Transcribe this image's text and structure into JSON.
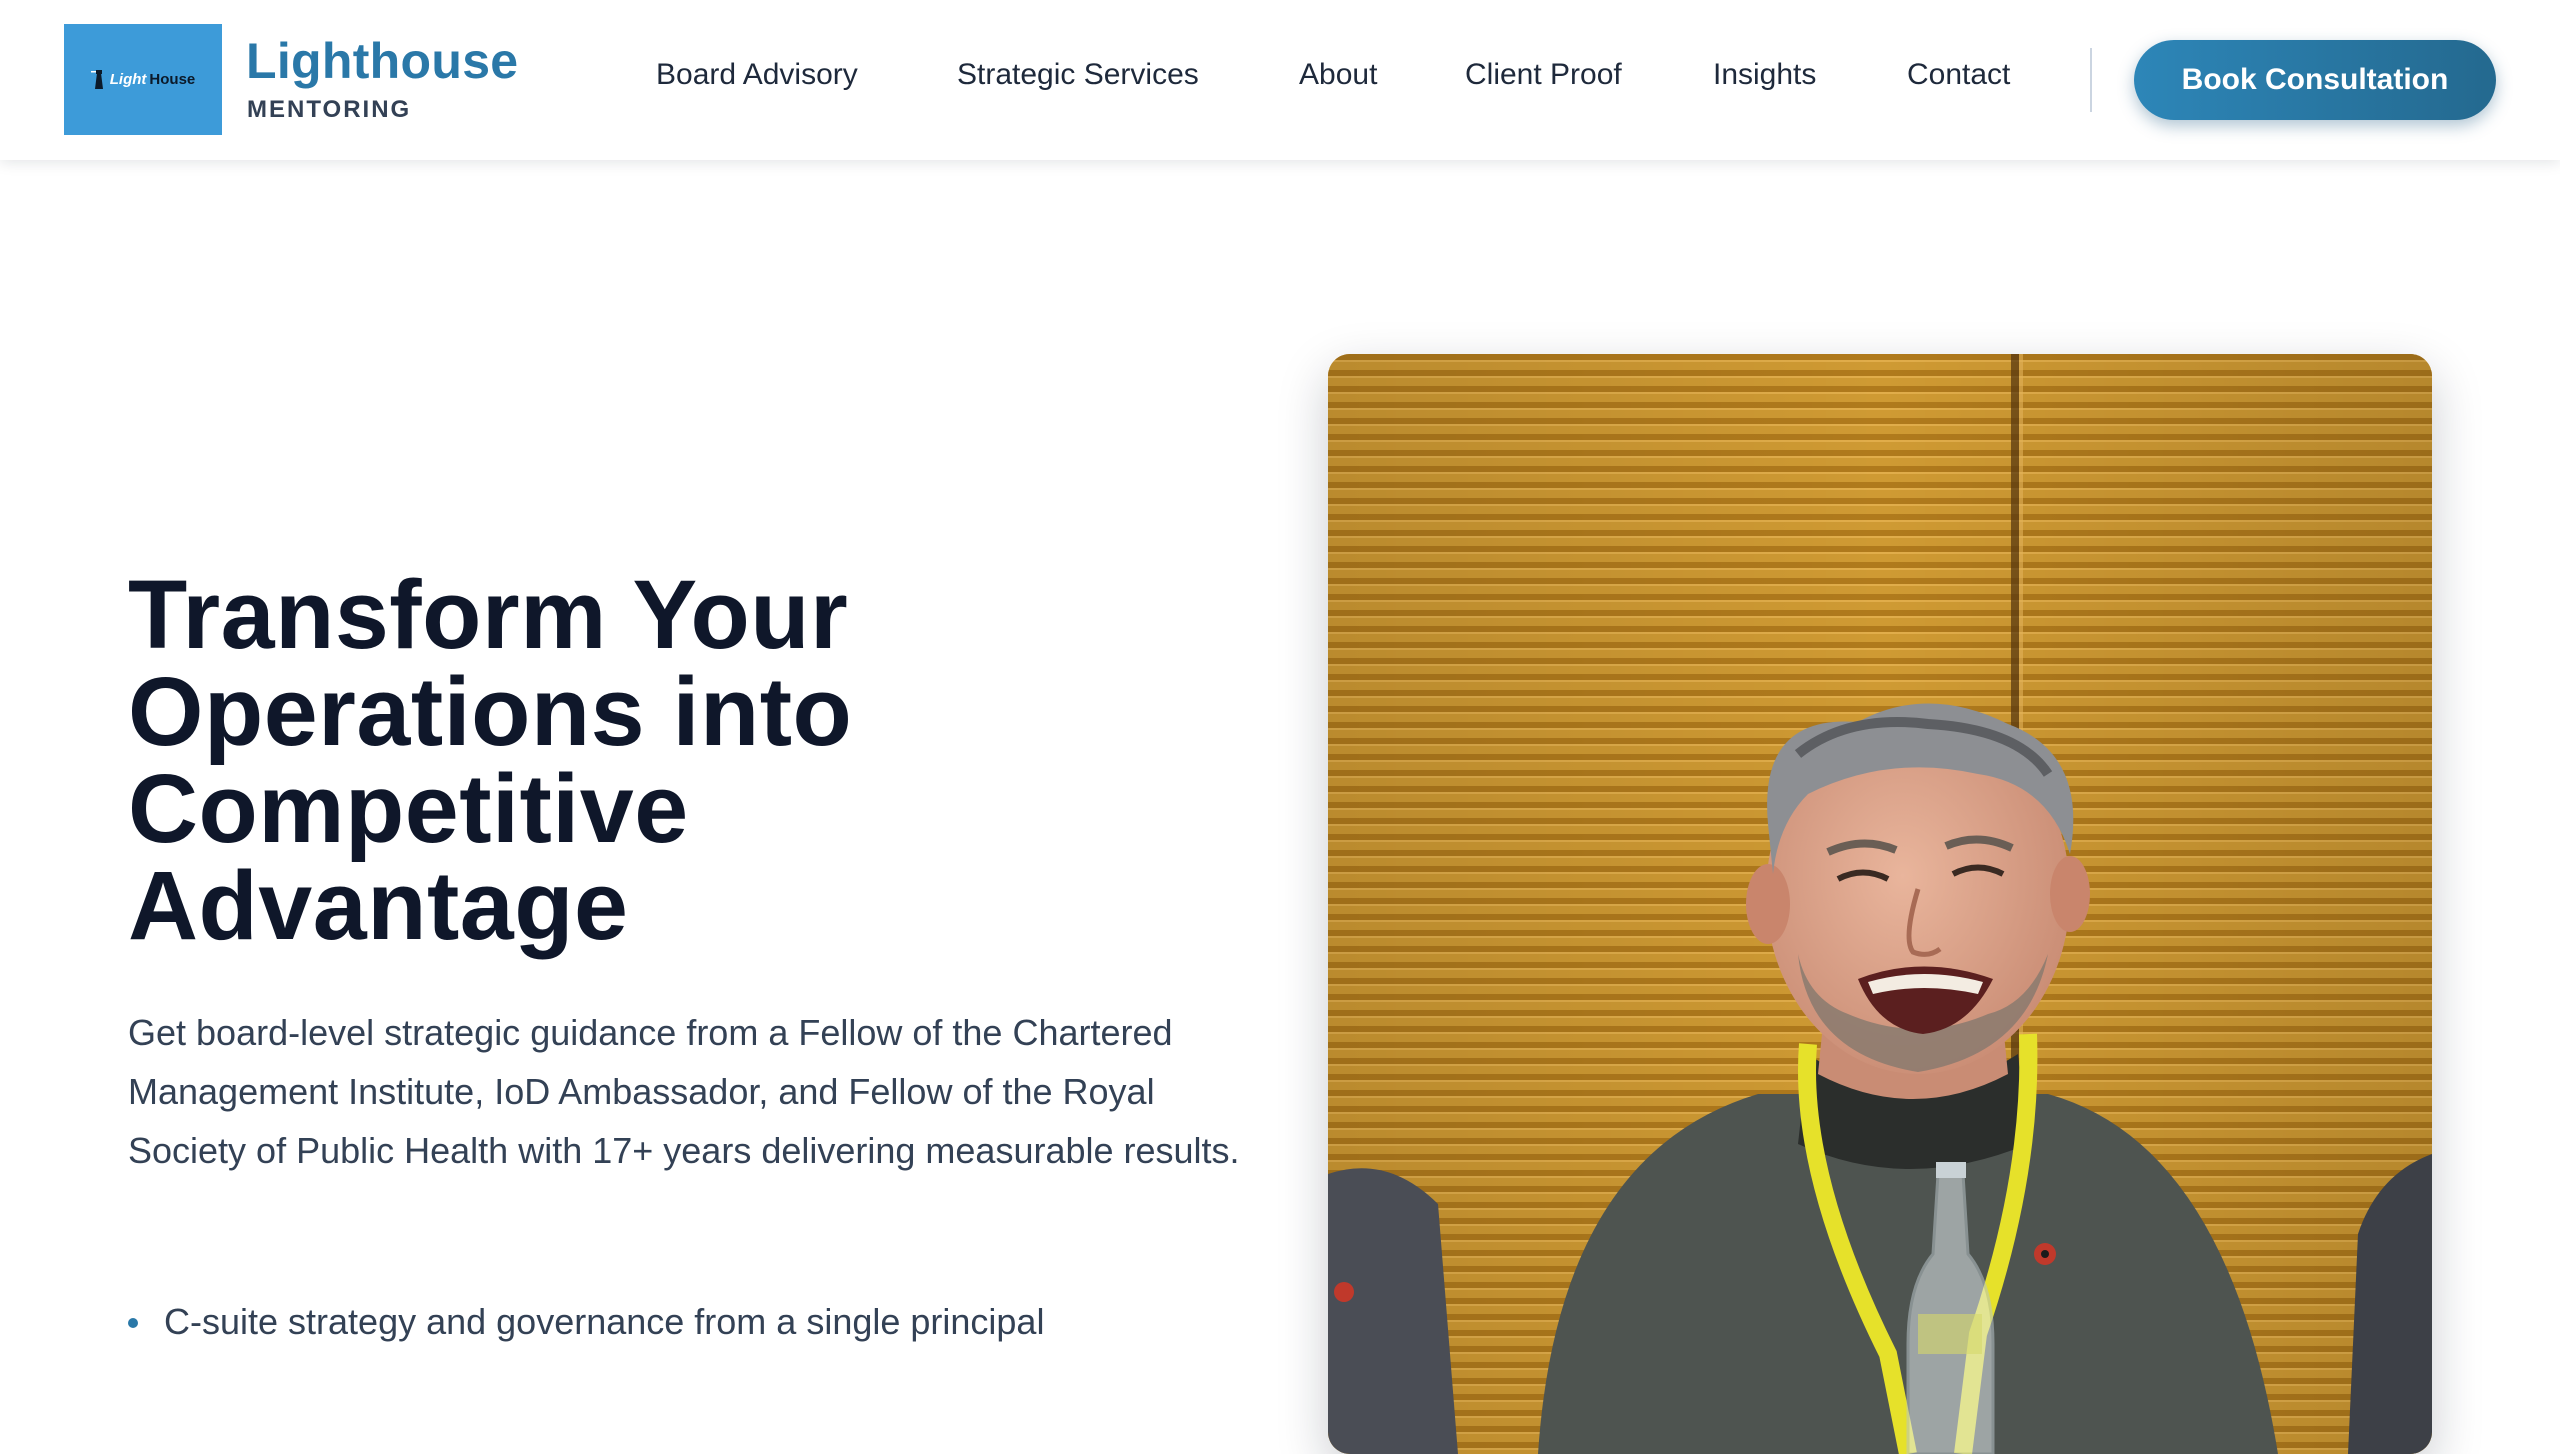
{
  "brand": {
    "logo_text_light": "Light",
    "logo_text_house": "House",
    "name": "Lighthouse",
    "subtitle": "MENTORING"
  },
  "nav": {
    "items": [
      {
        "label": "Board Advisory"
      },
      {
        "label": "Strategic Services"
      },
      {
        "label": "About"
      },
      {
        "label": "Client Proof"
      },
      {
        "label": "Insights"
      },
      {
        "label": "Contact"
      }
    ],
    "cta_label": "Book Consultation"
  },
  "hero": {
    "title_lines": [
      "Transform Your",
      "Operations into",
      "Competitive",
      "Advantage"
    ],
    "description": "Get board-level strategic guidance from a Fellow of the Chartered Management Institute, IoD Ambassador, and Fellow of the Royal Society of Public Health with 17+ years delivering measurable results.",
    "bullets": [
      {
        "text": "C-suite strategy and governance from a single principal"
      }
    ]
  },
  "colors": {
    "brand_blue": "#2a78a8",
    "logo_bg": "#3d9bd9",
    "cta_start": "#2d86b8",
    "cta_end": "#24698f",
    "heading": "#0f172a",
    "body_text": "#334155"
  },
  "photo": {
    "subject": "smiling man with grey hair wearing a dark turtleneck and yellow lanyard in front of a wooden slatted wall"
  }
}
